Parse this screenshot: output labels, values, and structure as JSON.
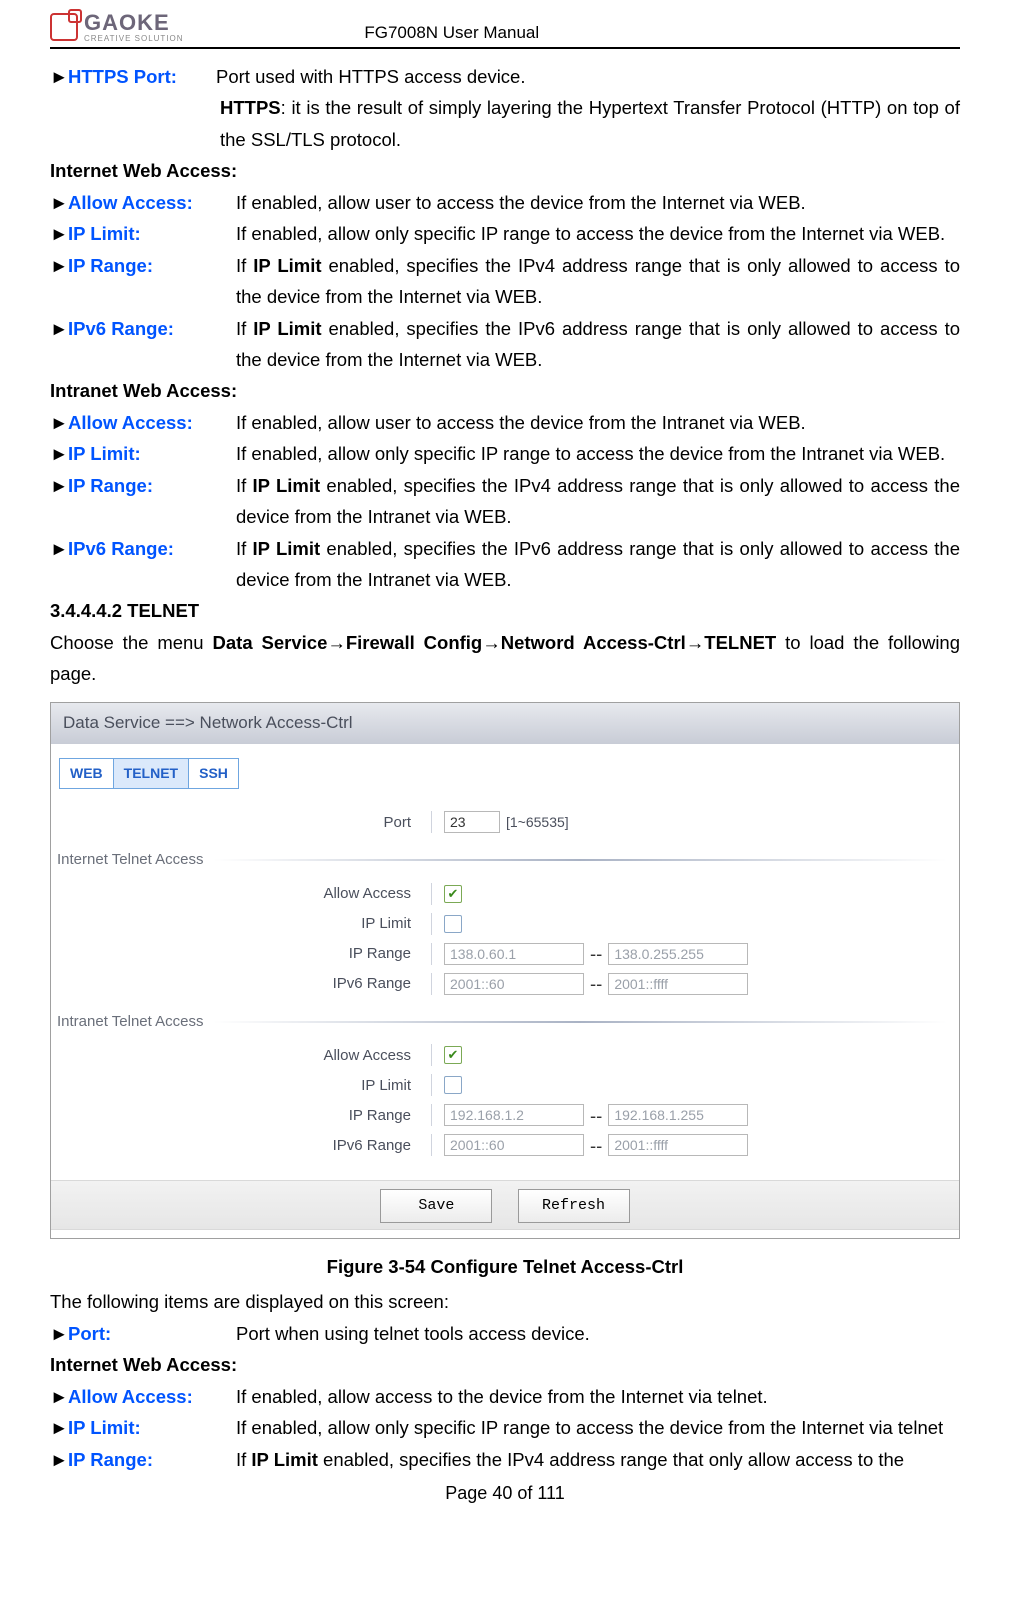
{
  "header": {
    "logo_main": "GAOKE",
    "logo_sub": "CREATIVE SOLUTION",
    "doc_title": "FG7008N User Manual"
  },
  "text": {
    "arrow": "►",
    "https_port_term": "HTTPS Port:",
    "https_port_desc": "Port used with HTTPS access device.",
    "https_bold": "HTTPS",
    "https_expl": ": it is the result of simply layering the Hypertext Transfer Protocol (HTTP) on top of the SSL/TLS protocol.",
    "internet_web_h": "Internet Web Access:",
    "allow_access_term": "Allow Access:",
    "internet_allow_desc": "If enabled, allow user to access the device from the Internet via WEB.",
    "ip_limit_term": "IP Limit:",
    "internet_iplimit_desc": "If enabled, allow only specific IP range to access the device from the Internet via WEB.",
    "ip_range_term": "IP Range:",
    "if_prefix": "If ",
    "ip_limit_bold": "IP Limit",
    "internet_iprange_desc": " enabled, specifies the IPv4 address range that is only allowed to access to the device from the Internet via WEB.",
    "ipv6_range_term": "IPv6 Range:",
    "internet_ipv6_desc": " enabled, specifies the IPv6 address range that is only allowed to access to the device from the Internet via WEB.",
    "intranet_web_h": "Intranet Web Access:",
    "intranet_allow_desc": "If enabled, allow user to access the device from the Intranet via WEB.",
    "intranet_iplimit_desc": "If enabled, allow only specific IP range to access the device from the Intranet via WEB.",
    "intranet_iprange_desc": " enabled, specifies the IPv4 address range that is only allowed to access the device from the Intranet via WEB.",
    "intranet_ipv6_desc": " enabled, specifies the IPv6 address range that is only allowed to access the device from the Intranet via WEB.",
    "telnet_h": "3.4.4.4.2 TELNET",
    "telnet_intro_pre": "Choose the menu ",
    "telnet_intro_bold": "Data Service→Firewall Config→Netword Access-Ctrl→TELNET",
    "telnet_intro_post": " to load the following page.",
    "figure_caption": "Figure 3-54   Configure Telnet Access-Ctrl",
    "after_fig": "The following items are displayed on this screen:",
    "port_term": "Port:",
    "port_desc": "Port when using telnet tools access device.",
    "telnet_internet_allow": "If enabled, allow access to the device from the Internet via telnet.",
    "telnet_internet_iplimit": "If enabled, allow only specific IP range to access the device from the Internet via telnet",
    "telnet_internet_iprange_desc": " enabled, specifies the IPv4 address range that only allow access to the",
    "page_footer": "Page 40 of 111"
  },
  "ui": {
    "titlebar": "Data Service ==> Network Access-Ctrl",
    "tabs": {
      "web": "WEB",
      "telnet": "TELNET",
      "ssh": "SSH"
    },
    "labels": {
      "port": "Port",
      "allow_access": "Allow Access",
      "ip_limit": "IP Limit",
      "ip_range": "IP Range",
      "ipv6_range": "IPv6 Range"
    },
    "sections": {
      "internet": "Internet Telnet Access",
      "intranet": "Intranet Telnet Access"
    },
    "values": {
      "port": "23",
      "port_hint": "[1~65535]",
      "internet": {
        "allow_checked": "✔",
        "ip_range_from": "138.0.60.1",
        "ip_range_to": "138.0.255.255",
        "ipv6_from": "2001::60",
        "ipv6_to": "2001::ffff"
      },
      "intranet": {
        "allow_checked": "✔",
        "ip_range_from": "192.168.1.2",
        "ip_range_to": "192.168.1.255",
        "ipv6_from": "2001::60",
        "ipv6_to": "2001::ffff"
      }
    },
    "buttons": {
      "save": "Save",
      "refresh": "Refresh"
    },
    "dash": "--"
  }
}
